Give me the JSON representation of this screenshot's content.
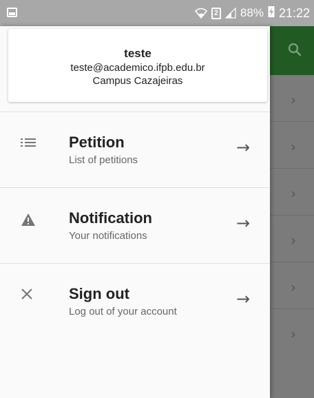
{
  "status_bar": {
    "battery": "88%",
    "sim_slot": "2",
    "time": "21:22"
  },
  "profile": {
    "name": "teste",
    "email": "teste@academico.ifpb.edu.br",
    "campus": "Campus Cazajeiras"
  },
  "menu": [
    {
      "title": "Petition",
      "subtitle": "List of petitions",
      "icon": "list-icon"
    },
    {
      "title": "Notification",
      "subtitle": "Your notifications",
      "icon": "warning-icon"
    },
    {
      "title": "Sign out",
      "subtitle": "Log out of your account",
      "icon": "close-icon"
    }
  ],
  "background_list_chevron": "›",
  "colors": {
    "toolbar_green": "#225a24",
    "status_bar": "#a8a8a8",
    "drawer_bg": "#fafafa"
  }
}
